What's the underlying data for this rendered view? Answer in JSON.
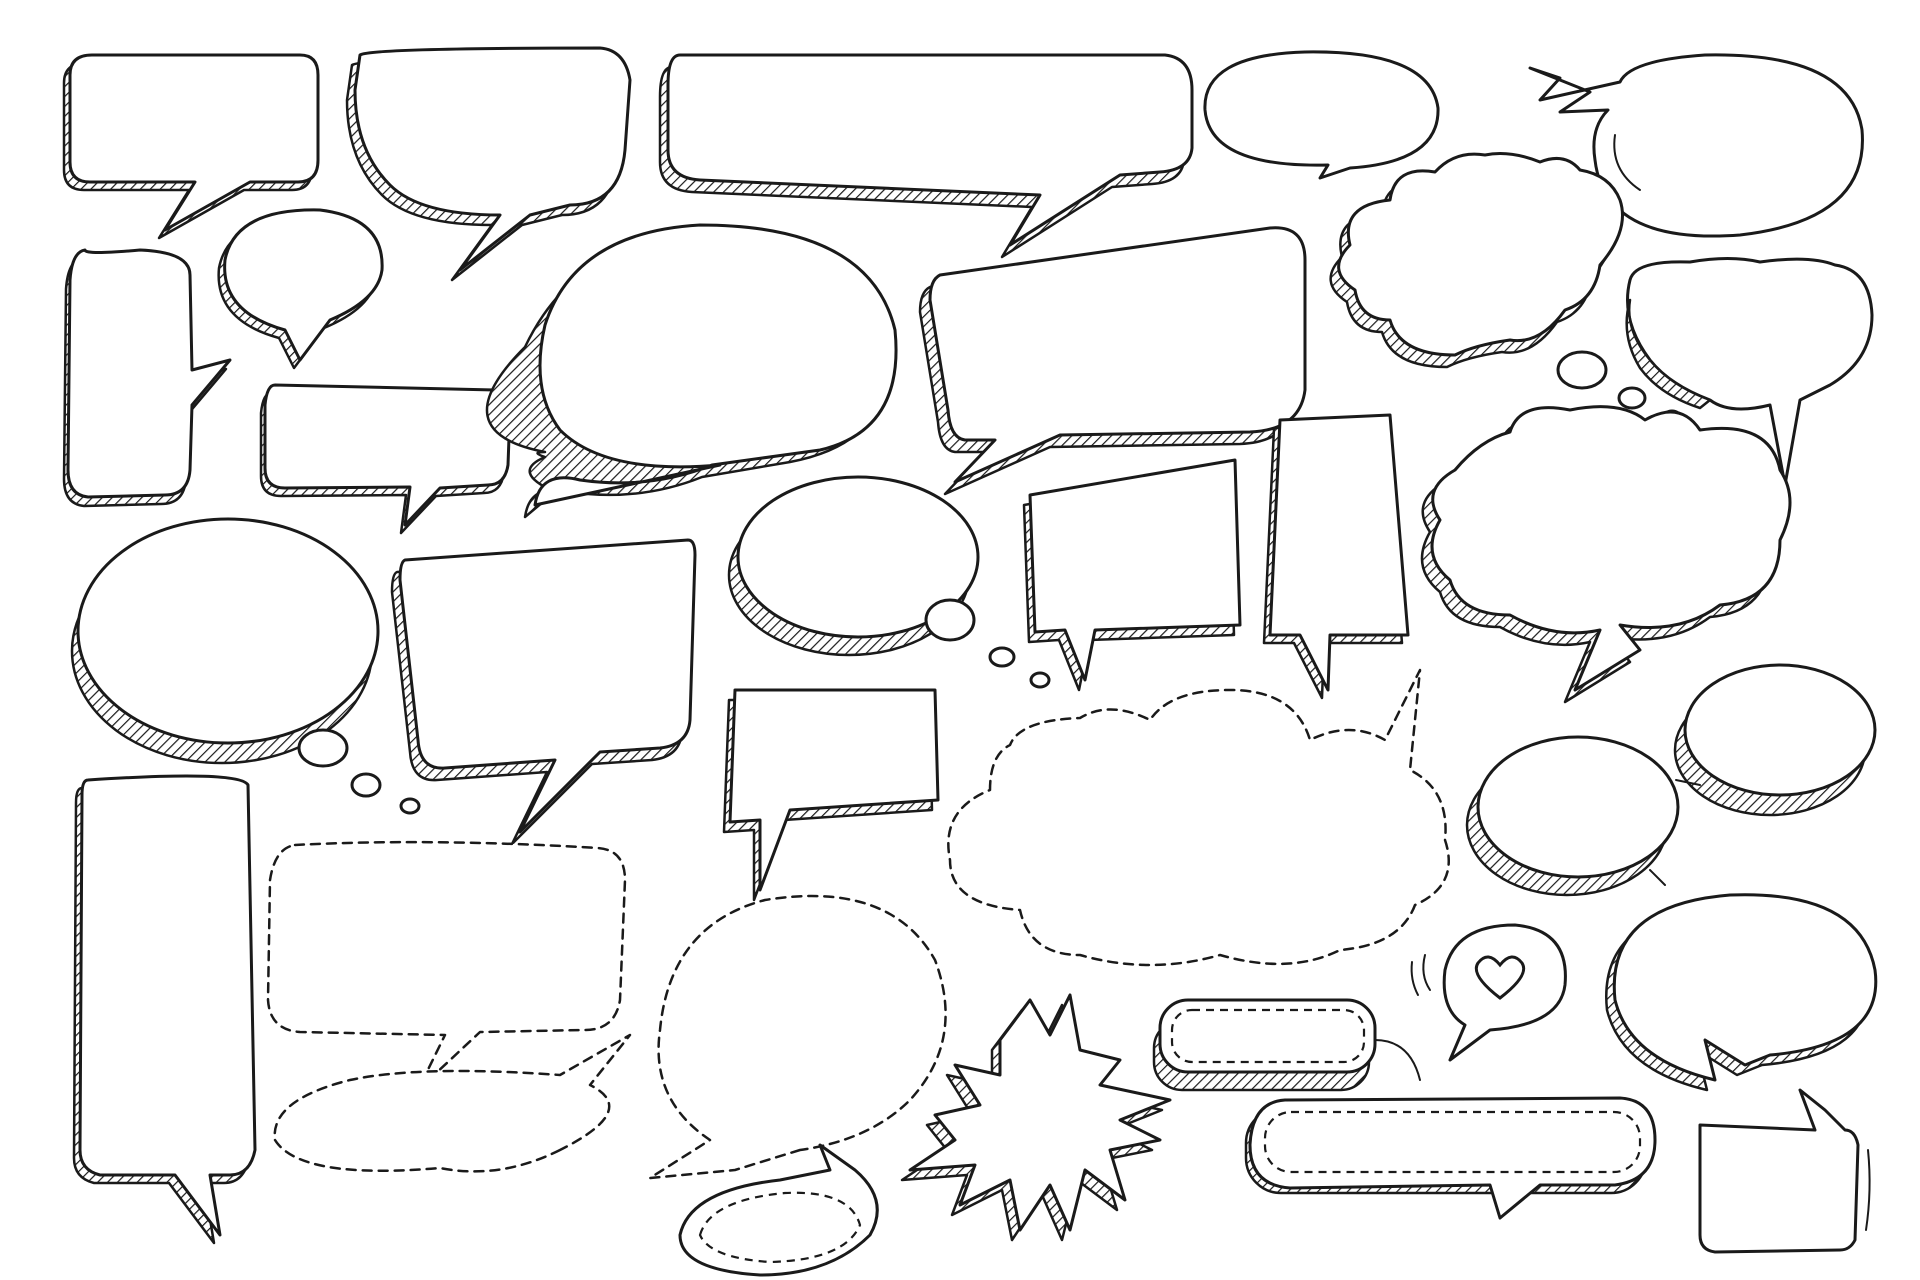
{
  "image": {
    "description_kind": "illustration",
    "background_color": "#ffffff",
    "ink_color": "#1a1a1a",
    "items": [
      {
        "name": "speech-bubble-rounded-rect-1",
        "style": "solid-hatched"
      },
      {
        "name": "speech-bubble-wide-top",
        "style": "solid-hatched"
      },
      {
        "name": "speech-bubble-long-banner",
        "style": "solid-hatched"
      },
      {
        "name": "speech-bubble-oval-small",
        "style": "solid"
      },
      {
        "name": "speech-bubble-oval-zigzag",
        "style": "solid"
      },
      {
        "name": "speech-bubble-tall-rect",
        "style": "solid-hatched"
      },
      {
        "name": "speech-bubble-small-round",
        "style": "solid-hatched"
      },
      {
        "name": "speech-bubble-small-rect",
        "style": "solid-hatched"
      },
      {
        "name": "speech-bubble-large-oval",
        "style": "solid-hatched"
      },
      {
        "name": "speech-bubble-trapezoid",
        "style": "solid-hatched"
      },
      {
        "name": "thought-cloud-top-right",
        "style": "solid-hatched"
      },
      {
        "name": "speech-bubble-cloud-right",
        "style": "solid-hatched"
      },
      {
        "name": "thought-oval-left",
        "style": "solid-hatched"
      },
      {
        "name": "speech-bubble-square-1",
        "style": "solid-hatched"
      },
      {
        "name": "thought-oval-middle",
        "style": "solid-hatched"
      },
      {
        "name": "speech-bubble-slanted-rect",
        "style": "solid-hatched"
      },
      {
        "name": "speech-bubble-tall-box",
        "style": "solid-hatched"
      },
      {
        "name": "speech-bubble-cloud-large",
        "style": "solid-hatched"
      },
      {
        "name": "speech-bubble-small-box",
        "style": "solid-hatched"
      },
      {
        "name": "speech-cloud-dashed",
        "style": "dashed"
      },
      {
        "name": "speech-bubble-double-oval",
        "style": "solid-hatched"
      },
      {
        "name": "speech-bubble-tall-column",
        "style": "solid-hatched"
      },
      {
        "name": "speech-bubble-dashed-rect",
        "style": "dashed"
      },
      {
        "name": "speech-bubble-dashed-oval",
        "style": "dashed"
      },
      {
        "name": "speech-bubble-dashed-flat-oval",
        "style": "dashed"
      },
      {
        "name": "speech-bubble-dashed-small-oval",
        "style": "dashed"
      },
      {
        "name": "explosion-burst",
        "style": "solid-hatched"
      },
      {
        "name": "speech-bubble-heart",
        "style": "solid",
        "icon": "heart-icon"
      },
      {
        "name": "speech-bubble-pill-pair",
        "style": "solid-stitched"
      },
      {
        "name": "speech-bubble-oval-bottom-right",
        "style": "solid-hatched"
      },
      {
        "name": "speech-bubble-small-square-right",
        "style": "solid"
      }
    ]
  }
}
